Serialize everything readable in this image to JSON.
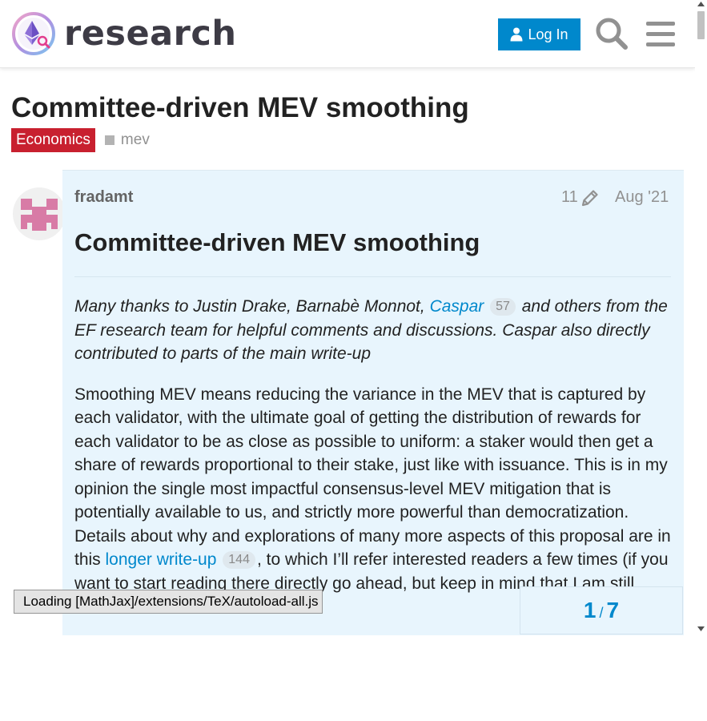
{
  "header": {
    "logo_text": "research",
    "login_label": "Log In",
    "search_icon": "search-icon",
    "menu_icon": "hamburger-menu-icon"
  },
  "topic": {
    "title": "Committee-driven MEV smoothing",
    "category": "Economics",
    "category_color": "#c8202f",
    "tag": "mev"
  },
  "post": {
    "username": "fradamt",
    "edit_count": "11",
    "date": "Aug '21",
    "heading": "Committee-driven MEV smoothing",
    "acks_before": "Many thanks to Justin Drake, Barnabè Monnot, ",
    "acks_link": "Caspar",
    "acks_link_count": "57",
    "acks_after": " and others from the EF research team for helpful comments and discussions. Caspar also directly contributed to parts of the main write-up",
    "para1_before": "Smoothing MEV means reducing the variance in the MEV that is captured by each validator, with the ultimate goal of getting the distribution of rewards for each validator to be as close as possible to uniform: a staker would then get a share of rewards proportional to their stake, just like with issuance. This is in my opinion the single most impactful consensus-level MEV mitigation that is potentially available to us, and strictly more powerful than democratization. Details about why and explorations of many more aspects of this proposal are in this ",
    "para1_link": "longer write-up",
    "para1_link_count": "144",
    "para1_after": ", to which I’ll refer interested readers a few times (if you want to start reading there directly go ahead, but keep in mind that I am still"
  },
  "progress": {
    "current": "1",
    "separator": "/",
    "total": "7"
  },
  "status": {
    "mathjax": "Loading [MathJax]/extensions/TeX/autoload-all.js"
  },
  "colors": {
    "accent": "#0088cc",
    "post_bg": "#e8f5fd"
  }
}
